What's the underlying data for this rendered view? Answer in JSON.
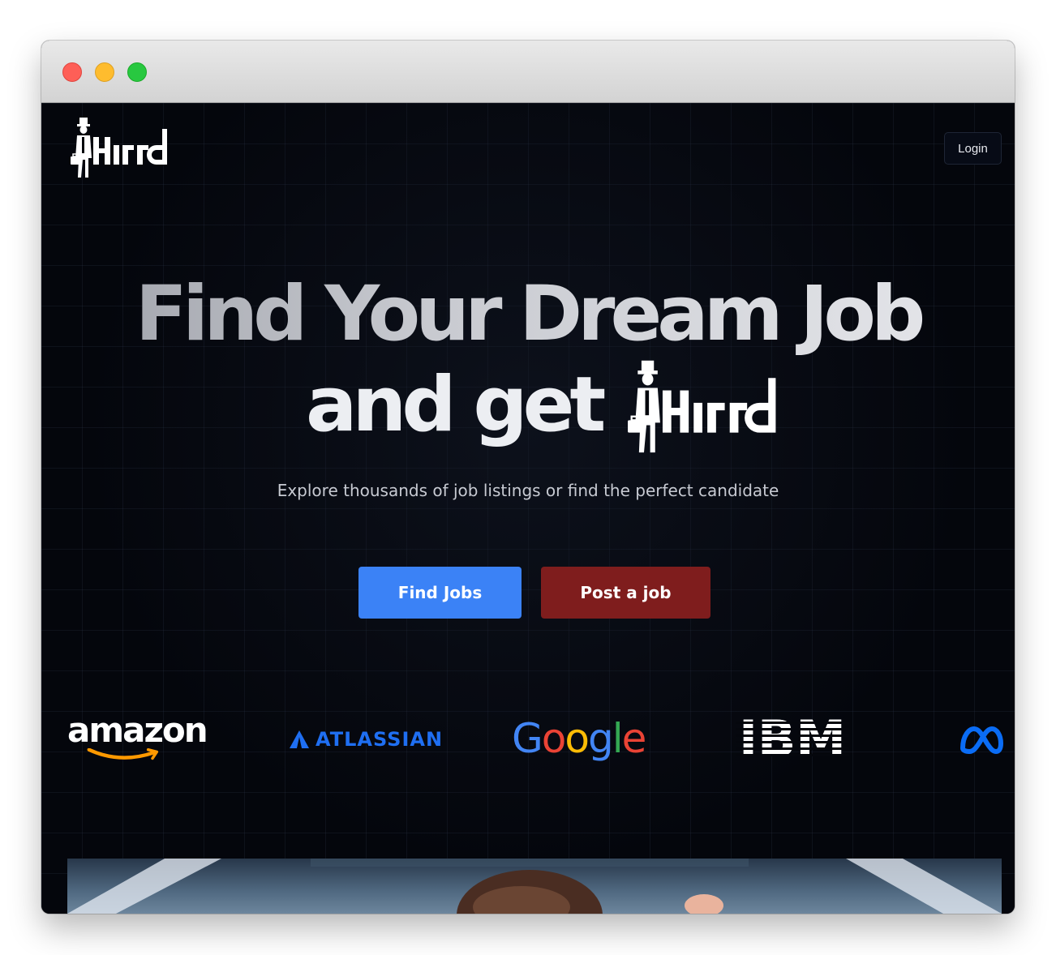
{
  "nav": {
    "brand_name": "Hirrd",
    "login_label": "Login"
  },
  "hero": {
    "line1": "Find Your Dream Job",
    "line2": "and get",
    "subtitle": "Explore thousands of job listings or find the perfect candidate"
  },
  "actions": {
    "find_jobs_label": "Find Jobs",
    "post_job_label": "Post a job"
  },
  "companies": {
    "amazon": "amazon",
    "atlassian": "ATLASSIAN",
    "google": [
      "G",
      "o",
      "o",
      "g",
      "l",
      "e"
    ],
    "ibm": "IBM",
    "meta": "Meta"
  },
  "colors": {
    "primary_button": "#3b82f6",
    "destructive_button": "#7f1d1d",
    "background": "#04060c",
    "atlassian_blue": "#1f6ff2",
    "google": [
      "#4285F4",
      "#EA4335",
      "#FBBC05",
      "#4285F4",
      "#34A853",
      "#EA4335"
    ],
    "meta_blue": "#0a6cf5"
  },
  "icons": {
    "window_controls": [
      "close-dot",
      "minimize-dot",
      "maximize-dot"
    ],
    "logo": "hirrd-logo-icon"
  }
}
